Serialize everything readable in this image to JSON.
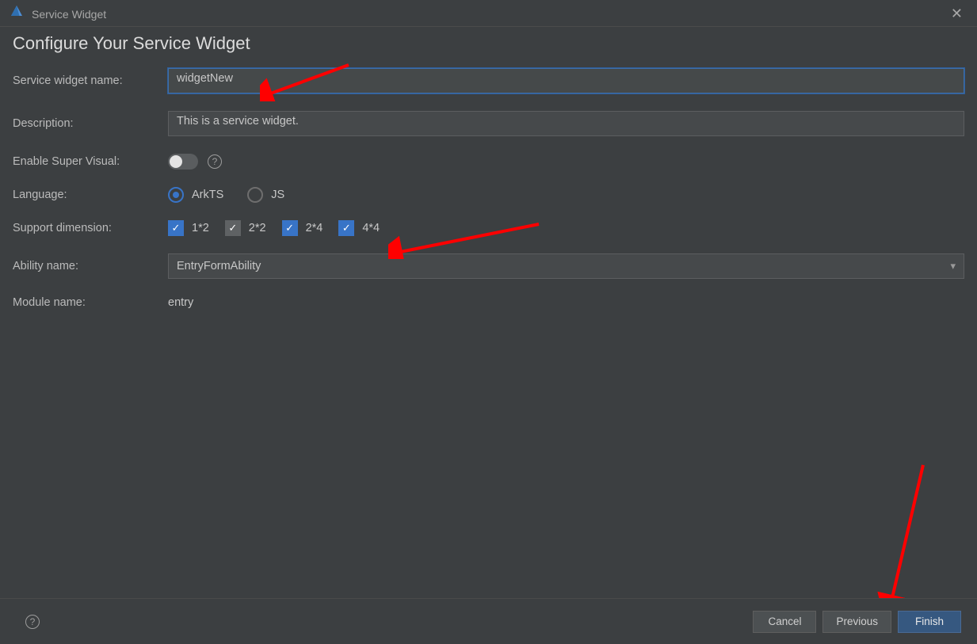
{
  "titlebar": {
    "title": "Service Widget"
  },
  "page": {
    "heading": "Configure Your Service Widget"
  },
  "form": {
    "name_label": "Service widget name:",
    "name_value": "widgetNew",
    "desc_label": "Description:",
    "desc_value": "This is a service widget.",
    "visual_label": "Enable Super Visual:",
    "visual_on": false,
    "lang_label": "Language:",
    "lang_options": [
      {
        "label": "ArkTS",
        "selected": true
      },
      {
        "label": "JS",
        "selected": false
      }
    ],
    "dim_label": "Support dimension:",
    "dim_options": [
      {
        "label": "1*2",
        "checked": true,
        "disabled": false
      },
      {
        "label": "2*2",
        "checked": true,
        "disabled": true
      },
      {
        "label": "2*4",
        "checked": true,
        "disabled": false
      },
      {
        "label": "4*4",
        "checked": true,
        "disabled": false
      }
    ],
    "ability_label": "Ability name:",
    "ability_value": "EntryFormAbility",
    "module_label": "Module name:",
    "module_value": "entry"
  },
  "footer": {
    "cancel": "Cancel",
    "previous": "Previous",
    "finish": "Finish"
  }
}
